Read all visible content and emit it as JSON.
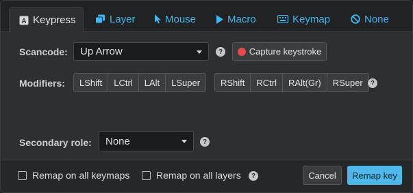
{
  "tabs": [
    {
      "label": "Keypress",
      "icon": "keypress-icon",
      "active": true
    },
    {
      "label": "Layer",
      "icon": "layer-icon"
    },
    {
      "label": "Mouse",
      "icon": "mouse-cursor-icon"
    },
    {
      "label": "Macro",
      "icon": "play-icon"
    },
    {
      "label": "Keymap",
      "icon": "keyboard-icon"
    },
    {
      "label": "None",
      "icon": "ban-icon"
    }
  ],
  "scancode": {
    "label": "Scancode:",
    "value": "Up Arrow",
    "help": "?",
    "capture_label": "Capture keystroke"
  },
  "modifiers": {
    "label": "Modifiers:",
    "left": [
      "LShift",
      "LCtrl",
      "LAlt",
      "LSuper"
    ],
    "right": [
      "RShift",
      "RCtrl",
      "RAlt(Gr)",
      "RSuper"
    ],
    "help": "?"
  },
  "secondary_role": {
    "label": "Secondary role:",
    "value": "None",
    "help": "?"
  },
  "footer": {
    "remap_all_keymaps": "Remap on all keymaps",
    "remap_all_layers": "Remap on all layers",
    "help": "?",
    "cancel_label": "Cancel",
    "remap_label": "Remap key"
  },
  "colors": {
    "accent": "#4fb8ea",
    "capture_dot": "#e74c4c",
    "background": "#2e2f31"
  }
}
